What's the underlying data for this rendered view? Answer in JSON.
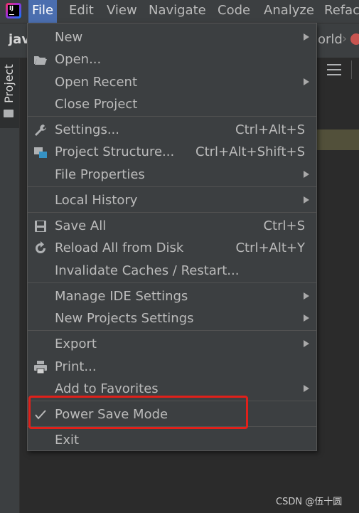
{
  "menubar": {
    "items": [
      {
        "label": "File",
        "mnemonic": "F"
      },
      {
        "label": "Edit",
        "mnemonic": "E"
      },
      {
        "label": "View",
        "mnemonic": "V"
      },
      {
        "label": "Navigate",
        "mnemonic": "N"
      },
      {
        "label": "Code",
        "mnemonic": "C"
      },
      {
        "label": "Analyze",
        "mnemonic": "z"
      },
      {
        "label": "Refact",
        "mnemonic": "R"
      }
    ]
  },
  "navbar": {
    "project_fragment": "jav",
    "file_fragment": "orld"
  },
  "tool_window": {
    "project_label": "Project"
  },
  "file_menu": {
    "items": [
      {
        "label": "New",
        "shortcut": "",
        "submenu": true,
        "icon": ""
      },
      {
        "label": "Open...",
        "shortcut": "",
        "submenu": false,
        "icon": "folder-open-icon"
      },
      {
        "label": "Open Recent",
        "shortcut": "",
        "submenu": true,
        "icon": ""
      },
      {
        "label": "Close Project",
        "shortcut": "",
        "submenu": false,
        "icon": ""
      },
      {
        "label": "Settings...",
        "shortcut": "Ctrl+Alt+S",
        "submenu": false,
        "icon": "wrench-icon"
      },
      {
        "label": "Project Structure...",
        "shortcut": "Ctrl+Alt+Shift+S",
        "submenu": false,
        "icon": "project-structure-icon"
      },
      {
        "label": "File Properties",
        "shortcut": "",
        "submenu": true,
        "icon": ""
      },
      {
        "label": "Local History",
        "shortcut": "",
        "submenu": true,
        "icon": ""
      },
      {
        "label": "Save All",
        "shortcut": "Ctrl+S",
        "submenu": false,
        "icon": "save-icon"
      },
      {
        "label": "Reload All from Disk",
        "shortcut": "Ctrl+Alt+Y",
        "submenu": false,
        "icon": "reload-icon"
      },
      {
        "label": "Invalidate Caches / Restart...",
        "shortcut": "",
        "submenu": false,
        "icon": ""
      },
      {
        "label": "Manage IDE Settings",
        "shortcut": "",
        "submenu": true,
        "icon": ""
      },
      {
        "label": "New Projects Settings",
        "shortcut": "",
        "submenu": true,
        "icon": ""
      },
      {
        "label": "Export",
        "shortcut": "",
        "submenu": true,
        "icon": ""
      },
      {
        "label": "Print...",
        "shortcut": "",
        "submenu": false,
        "icon": "printer-icon"
      },
      {
        "label": "Add to Favorites",
        "shortcut": "",
        "submenu": true,
        "icon": ""
      },
      {
        "label": "Power Save Mode",
        "shortcut": "",
        "submenu": false,
        "icon": "checkmark-icon",
        "checked": true
      },
      {
        "label": "Exit",
        "shortcut": "",
        "submenu": false,
        "icon": ""
      }
    ]
  },
  "watermark": "CSDN @伍十圆",
  "colors": {
    "menubar_bg": "#3c3f41",
    "menu_active": "#4b6eaf",
    "dropdown_bg": "#3c3f41",
    "text": "#bbbbbb",
    "highlight_box": "#e0201a",
    "editor_bg": "#2b2b2b"
  }
}
